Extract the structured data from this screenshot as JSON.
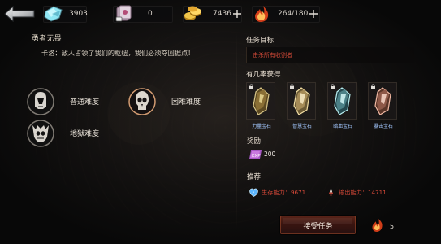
{
  "resources": {
    "crystals": "3903",
    "cards": "0",
    "gold": "7436",
    "stamina": "264/180"
  },
  "mission": {
    "title": "勇者无畏",
    "quote": "卡洛：敌人占领了我们的枢纽，我们必须夺回据点！"
  },
  "difficulties": [
    {
      "label": "普通难度"
    },
    {
      "label": "困难难度"
    },
    {
      "label": "地狱难度"
    }
  ],
  "right_panel": {
    "target_label": "任务目标:",
    "target_text": "击杀所有收割者",
    "drop_label": "有几率获得",
    "rewards": [
      {
        "label": "力量宝石"
      },
      {
        "label": "智慧宝石"
      },
      {
        "label": "暗血宝石"
      },
      {
        "label": "暴击宝石"
      }
    ],
    "bonus_label": "奖励:",
    "exp_label": "EXP",
    "exp_value": "200",
    "recommend_label": "推荐",
    "survival_text": "生存能力：9671",
    "damage_text": "输出能力：14711"
  },
  "actions": {
    "accept_label": "接受任务",
    "cost_value": "5"
  },
  "colors": {
    "accent_red": "#d54838",
    "gold_text": "#d8c09e",
    "selection_glow": "#f07a1d"
  }
}
